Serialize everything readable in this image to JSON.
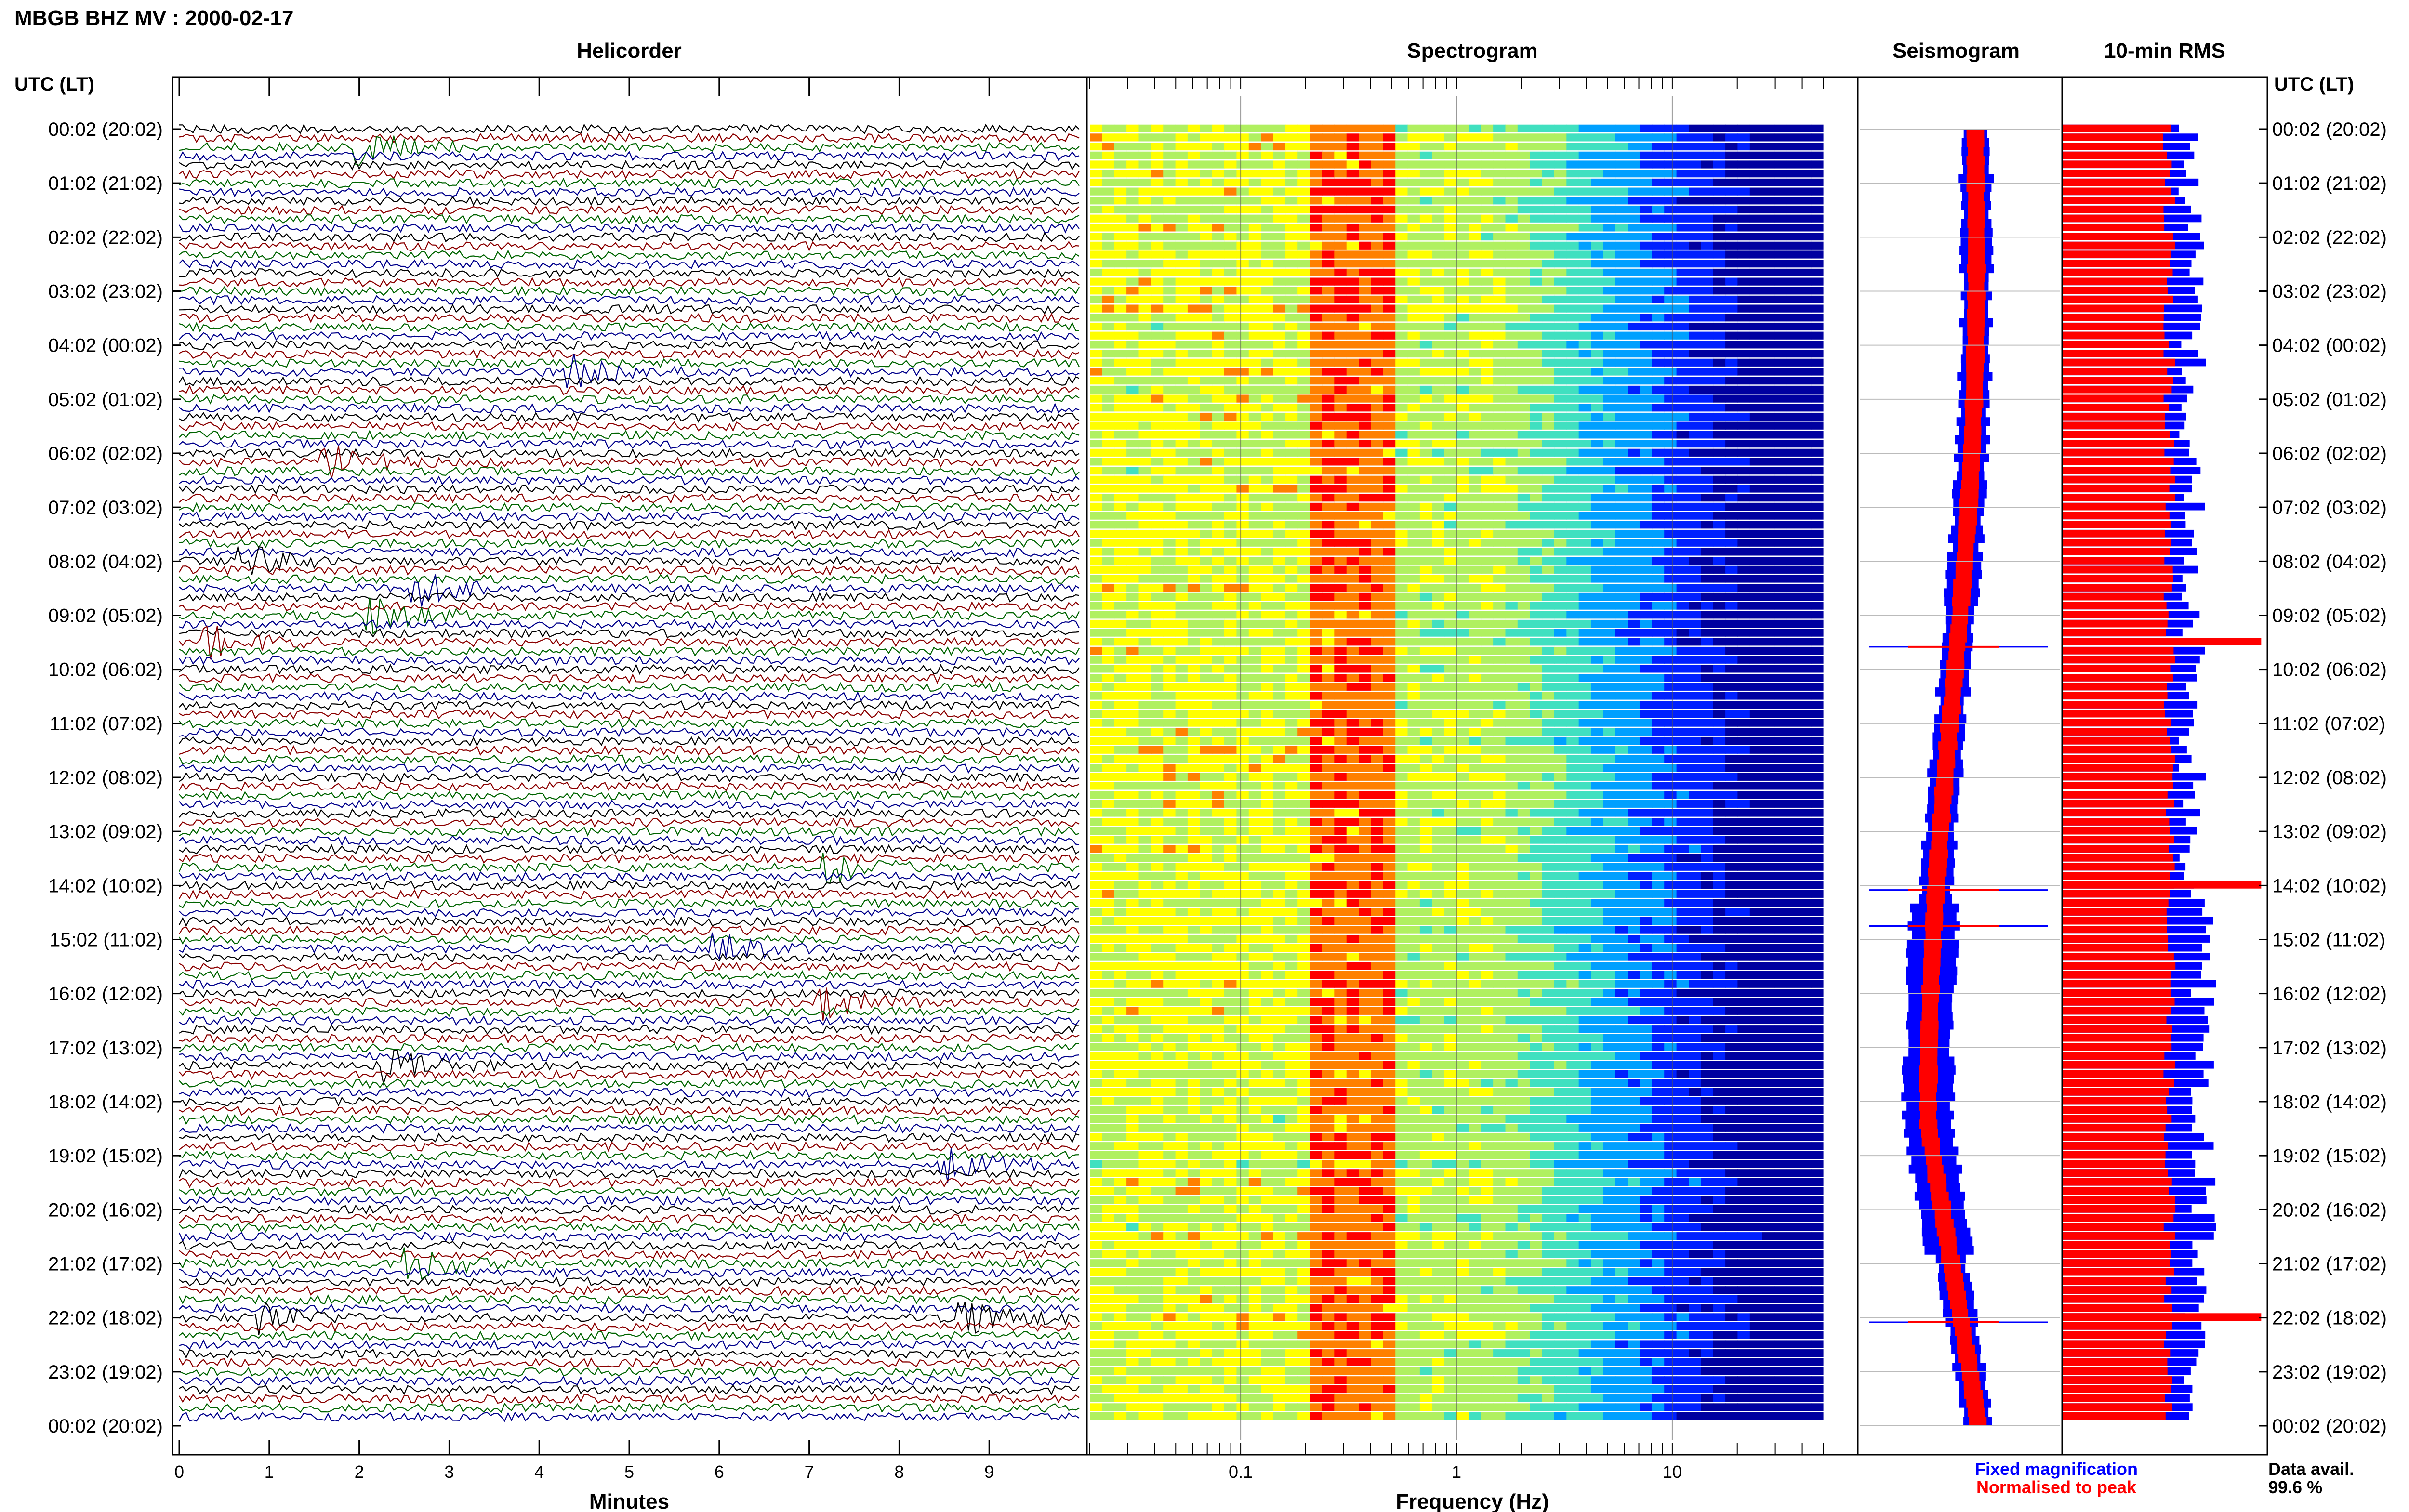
{
  "title": "MBGB BHZ MV : 2000-02-17",
  "panels": {
    "helicorder": "Helicorder",
    "spectrogram": "Spectrogram",
    "seismogram": "Seismogram",
    "rms": "10-min RMS"
  },
  "time_axis_label": "UTC (LT)",
  "time_ticks": [
    "00:02 (20:02)",
    "01:02 (21:02)",
    "02:02 (22:02)",
    "03:02 (23:02)",
    "04:02 (00:02)",
    "05:02 (01:02)",
    "06:02 (02:02)",
    "07:02 (03:02)",
    "08:02 (04:02)",
    "09:02 (05:02)",
    "10:02 (06:02)",
    "11:02 (07:02)",
    "12:02 (08:02)",
    "13:02 (09:02)",
    "14:02 (10:02)",
    "15:02 (11:02)",
    "16:02 (12:02)",
    "17:02 (13:02)",
    "18:02 (14:02)",
    "19:02 (15:02)",
    "20:02 (16:02)",
    "21:02 (17:02)",
    "22:02 (18:02)",
    "23:02 (19:02)",
    "00:02 (20:02)"
  ],
  "legend": {
    "fixed": "Fixed magnification",
    "normalised": "Normalised to peak",
    "fixed_color": "#0000ff",
    "normalised_color": "#ff0000"
  },
  "data_avail": {
    "label": "Data avail.",
    "value": "99.6 %"
  },
  "colors": {
    "trace_cycle": [
      "#000000",
      "#8b0000",
      "#006400",
      "#00008b"
    ],
    "seismogram_fixed": "#0000ff",
    "seismogram_norm": "#ff0000"
  },
  "chart_data": [
    {
      "type": "line",
      "title": "Helicorder",
      "xlabel": "Minutes",
      "xlim": [
        0,
        10
      ],
      "x_ticks": [
        0,
        1,
        2,
        3,
        4,
        5,
        6,
        7,
        8,
        9
      ],
      "rows": 144,
      "row_minutes": 10,
      "events": [
        {
          "row": 2,
          "minute": 2.1,
          "color_index": 3
        },
        {
          "row": 27,
          "minute": 4.4,
          "color_index": 3
        },
        {
          "row": 37,
          "minute": 1.7,
          "color_index": 3
        },
        {
          "row": 48,
          "minute": 0.8,
          "color_index": 0
        },
        {
          "row": 51,
          "minute": 2.7,
          "color_index": 2
        },
        {
          "row": 54,
          "minute": 2.2,
          "color_index": 3
        },
        {
          "row": 57,
          "minute": 0.4,
          "color_index": 1
        },
        {
          "row": 82,
          "minute": 7.3,
          "color_index": 0
        },
        {
          "row": 91,
          "minute": 6.0,
          "color_index": 3
        },
        {
          "row": 97,
          "minute": 7.2,
          "color_index": 0
        },
        {
          "row": 104,
          "minute": 2.4,
          "color_index": 1
        },
        {
          "row": 115,
          "minute": 8.6,
          "color_index": 0
        },
        {
          "row": 126,
          "minute": 2.6,
          "color_index": 3
        },
        {
          "row": 132,
          "minute": 8.8,
          "color_index": 0
        },
        {
          "row": 132,
          "minute": 0.9,
          "color_index": 1
        }
      ]
    },
    {
      "type": "heatmap",
      "title": "Spectrogram",
      "xlabel": "Frequency (Hz)",
      "xscale": "log",
      "xlim": [
        0.02,
        50
      ],
      "x_ticks": [
        0.1,
        1,
        10
      ],
      "x_tick_labels": [
        "0.1",
        "1",
        "10"
      ],
      "rows": 144,
      "colormap": [
        "#0000a0",
        "#0020ff",
        "#00a0ff",
        "#40e0c0",
        "#b0f060",
        "#ffff00",
        "#ff8000",
        "#ff0000"
      ],
      "peak_band_hz": [
        0.2,
        0.5
      ],
      "falloff_start_hz": 1.5
    },
    {
      "type": "line",
      "title": "Seismogram",
      "series": [
        {
          "name": "Fixed magnification",
          "color": "#0000ff"
        },
        {
          "name": "Normalised to peak",
          "color": "#ff0000"
        }
      ],
      "spikes_rows": [
        57,
        84,
        88,
        132
      ]
    },
    {
      "type": "bar",
      "title": "10-min RMS",
      "rows": 144,
      "series": [
        {
          "name": "Fixed magnification",
          "color": "#0000ff",
          "mean_fraction": 0.62
        },
        {
          "name": "Normalised to peak",
          "color": "#ff0000",
          "mean_fraction": 0.52
        }
      ]
    }
  ]
}
